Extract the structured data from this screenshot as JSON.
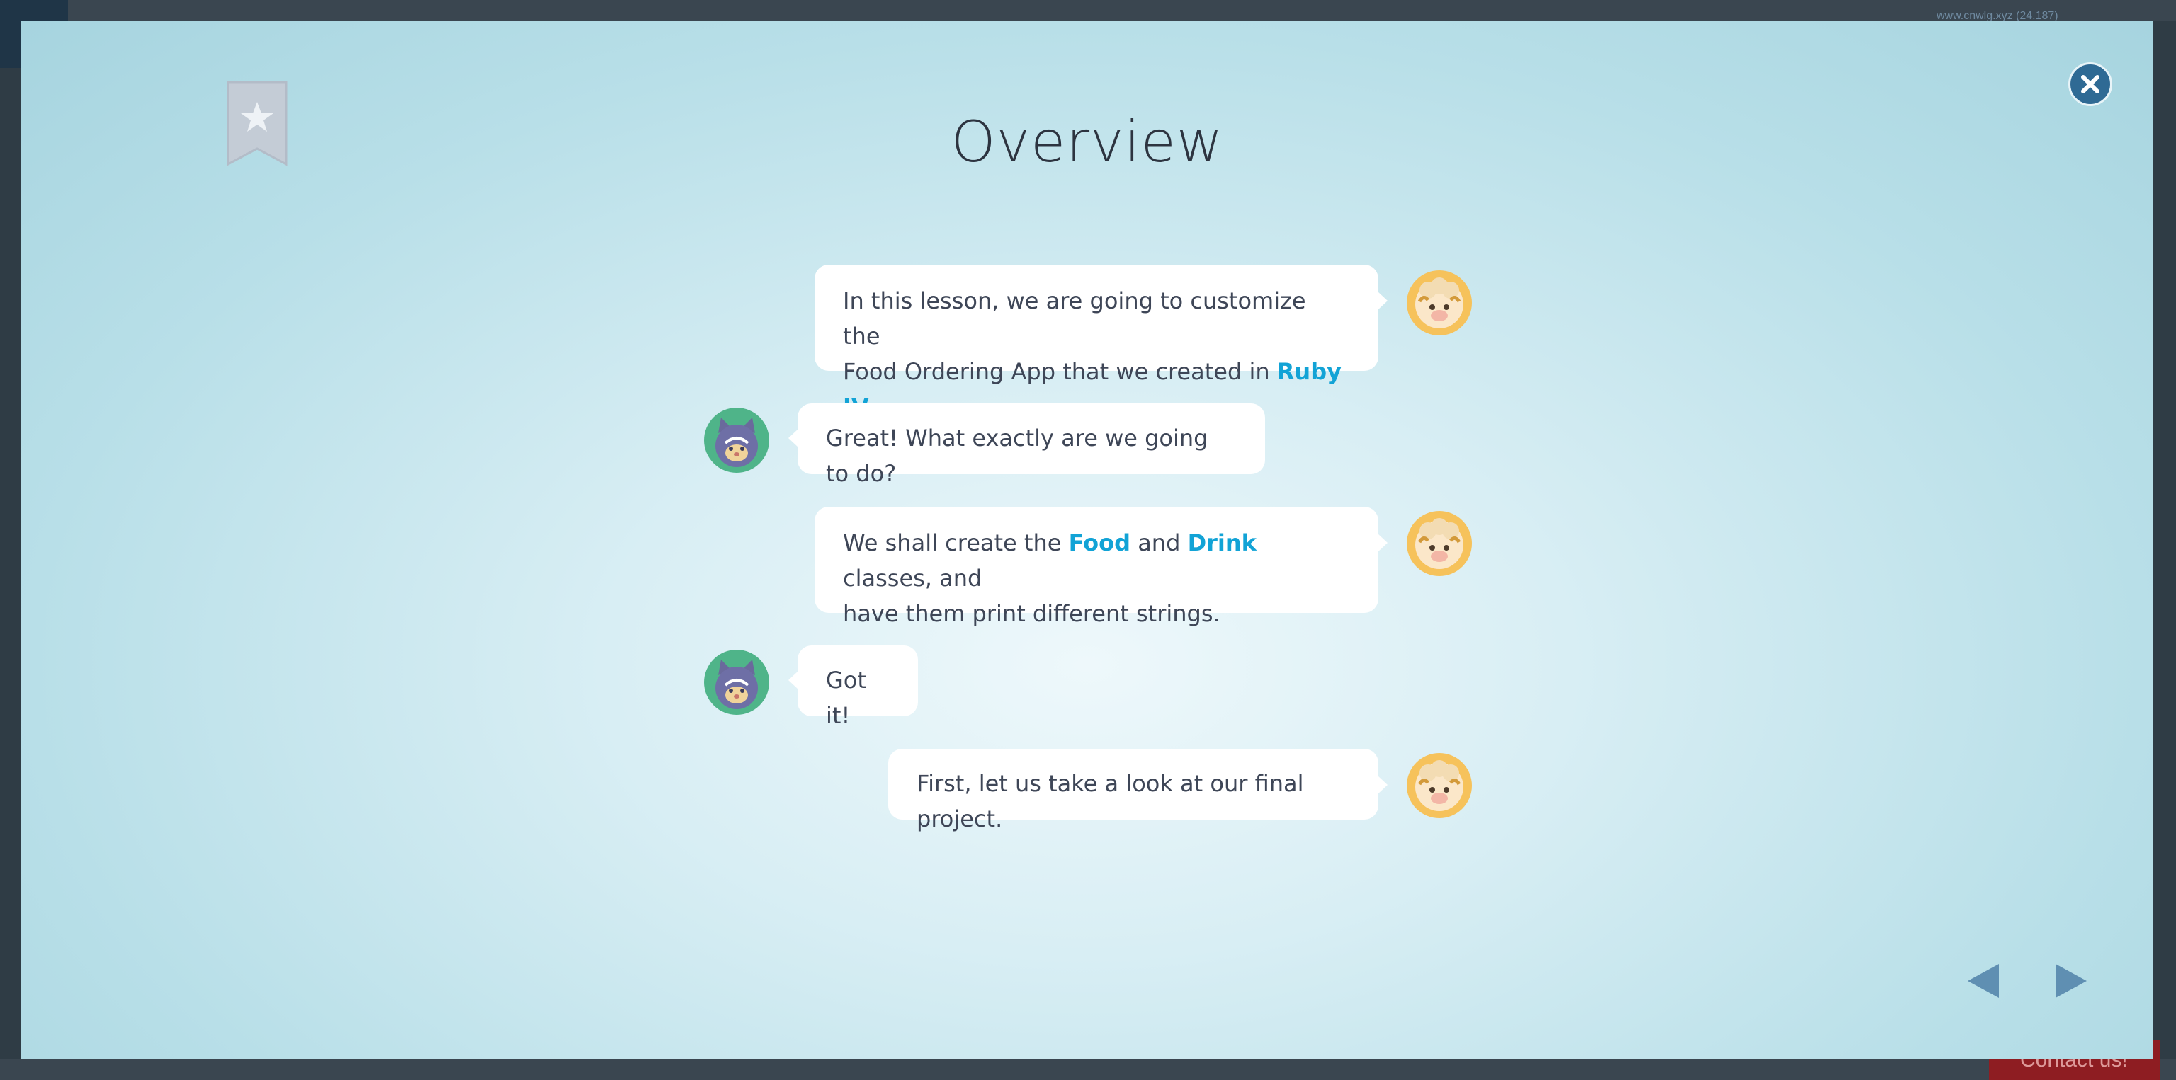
{
  "background_page": {
    "url_text": "www.cnwlg.xyz (24.187)",
    "contact_label": "Contact us!"
  },
  "modal": {
    "title": "Overview",
    "colors": {
      "highlight": "#12a3d6",
      "close_button": "#2f6a94",
      "nav_arrow": "#5f8fb2",
      "bookmark": "#c4ccd6"
    },
    "icons": {
      "bookmark": "bookmark-star-icon",
      "close": "close-icon",
      "prev": "prev-arrow-icon",
      "next": "next-arrow-icon"
    },
    "messages": [
      {
        "speaker": "sheep",
        "side": "right",
        "line1_pre": "In this lesson, we are going to customize the",
        "line2_pre": "Food Ordering App that we created in ",
        "highlight": "Ruby IV",
        "line2_post": "."
      },
      {
        "speaker": "cat",
        "side": "left",
        "text": "Great! What exactly are we going to do?"
      },
      {
        "speaker": "sheep",
        "side": "right",
        "pre": "We shall create the ",
        "highlight1": "Food",
        "mid": " and ",
        "highlight2": "Drink",
        "post": " classes, and",
        "line2": "have them print different strings."
      },
      {
        "speaker": "cat",
        "side": "left",
        "text": "Got it!"
      },
      {
        "speaker": "sheep",
        "side": "right",
        "text": "First, let us take a look at our final project."
      }
    ]
  }
}
